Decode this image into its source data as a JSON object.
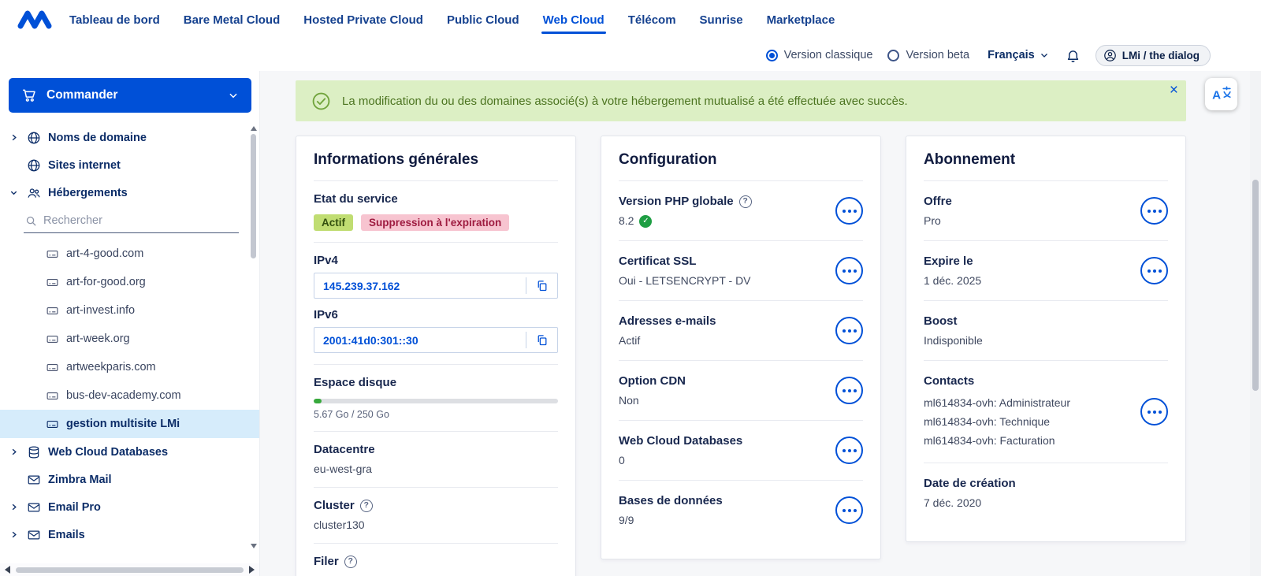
{
  "colors": {
    "primary": "#0050d7",
    "banner_bg": "#dcefc4",
    "badge_active_bg": "#c0dd72",
    "badge_deletion_bg": "#f7c4d0",
    "selected_item_bg": "#d6ecfb",
    "progress_fill": "#37a93c"
  },
  "header": {
    "nav_items": [
      "Tableau de bord",
      "Bare Metal Cloud",
      "Hosted Private Cloud",
      "Public Cloud",
      "Web Cloud",
      "Télécom",
      "Sunrise",
      "Marketplace"
    ],
    "version_classic_label": "Version classique",
    "version_beta_label": "Version beta",
    "language_label": "Français",
    "user_label": "LMi / the dialog"
  },
  "sidebar": {
    "order_button_label": "Commander",
    "search_placeholder": "Rechercher",
    "item_domains": "Noms de domaine",
    "item_websites": "Sites internet",
    "item_hostings": "Hébergements",
    "item_webclouddb": "Web Cloud Databases",
    "item_zimbra": "Zimbra Mail",
    "item_emailpro": "Email Pro",
    "item_emails": "Emails",
    "hostings": [
      "art-4-good.com",
      "art-for-good.org",
      "art-invest.info",
      "art-week.org",
      "artweekparis.com",
      "bus-dev-academy.com",
      "gestion multisite LMi"
    ]
  },
  "banner": {
    "message": "La modification du ou des domaines associé(s) à votre hébergement mutualisé a été effectuée avec succès.",
    "close_label": "×"
  },
  "general_card": {
    "title": "Informations générales",
    "service_state_label": "Etat du service",
    "state_active": "Actif",
    "state_deletion": "Suppression à l'expiration",
    "ipv4_label": "IPv4",
    "ipv4_value": "145.239.37.162",
    "ipv6_label": "IPv6",
    "ipv6_value": "2001:41d0:301::30",
    "disk_label": "Espace disque",
    "disk_usage": "5.67 Go / 250 Go",
    "disk_percent": 2.3,
    "datacentre_label": "Datacentre",
    "datacentre_value": "eu-west-gra",
    "cluster_label": "Cluster",
    "cluster_value": "cluster130",
    "filer_label": "Filer"
  },
  "config_card": {
    "title": "Configuration",
    "rows": [
      {
        "label": "Version PHP globale",
        "value": "8.2"
      },
      {
        "label": "Certificat SSL",
        "value": "Oui - LETSENCRYPT - DV"
      },
      {
        "label": "Adresses e-mails",
        "value": "Actif"
      },
      {
        "label": "Option CDN",
        "value": "Non"
      },
      {
        "label": "Web Cloud Databases",
        "value": "0"
      },
      {
        "label": "Bases de données",
        "value": "9/9"
      }
    ]
  },
  "subscription_card": {
    "title": "Abonnement",
    "offer_label": "Offre",
    "offer_value": "Pro",
    "expiry_label": "Expire le",
    "expiry_value": "1 déc. 2025",
    "boost_label": "Boost",
    "boost_value": "Indisponible",
    "contacts_label": "Contacts",
    "contacts": [
      "ml614834-ovh: Administrateur",
      "ml614834-ovh: Technique",
      "ml614834-ovh: Facturation"
    ],
    "creation_label": "Date de création",
    "creation_value": "7 déc. 2020"
  }
}
